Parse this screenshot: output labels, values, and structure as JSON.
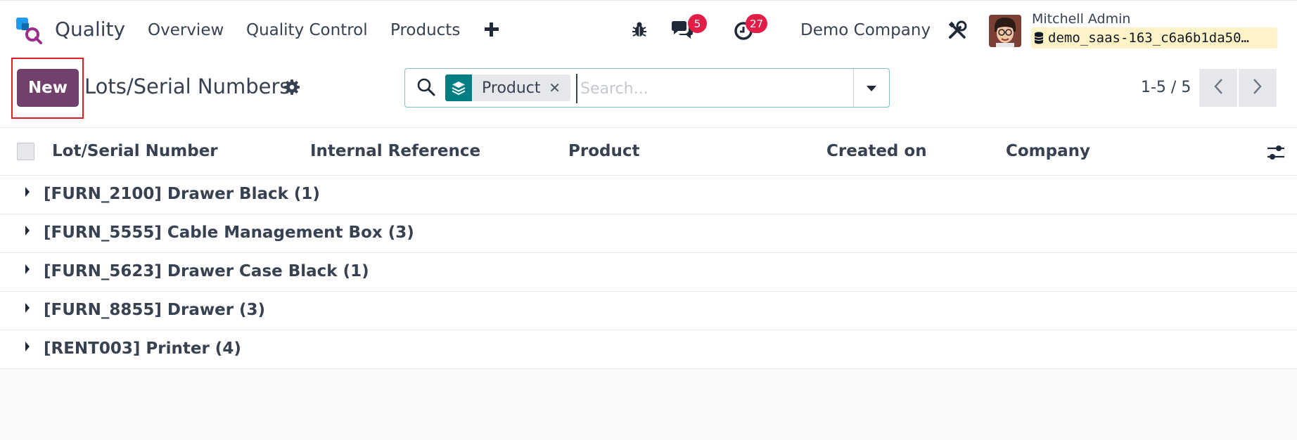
{
  "app": {
    "name": "Quality",
    "menu": [
      "Overview",
      "Quality Control",
      "Products"
    ]
  },
  "systray": {
    "messages_count": "5",
    "activities_count": "27",
    "company": "Demo Company",
    "user_name": "Mitchell Admin",
    "database": "demo_saas-163_c6a6b1da50…"
  },
  "control": {
    "new_label": "New",
    "title": "Lots/Serial Numbers",
    "search": {
      "facet": "Product",
      "placeholder": "Search..."
    },
    "pager": "1-5 / 5"
  },
  "list": {
    "columns": [
      "Lot/Serial Number",
      "Internal Reference",
      "Product",
      "Created on",
      "Company"
    ],
    "groups": [
      "[FURN_2100] Drawer Black (1)",
      "[FURN_5555] Cable Management Box (3)",
      "[FURN_5623] Drawer Case Black (1)",
      "[FURN_8855] Drawer (3)",
      "[RENT003] Printer (4)"
    ]
  },
  "colors": {
    "primary": "#71406b",
    "facet": "#017e84",
    "badge": "#e11d48",
    "highlight": "#e11d24"
  },
  "icons": [
    "quality-logo-icon",
    "plus-icon",
    "bug-icon",
    "chat-icon",
    "clock-icon",
    "settings-tools-icon",
    "database-icon",
    "gear-icon",
    "search-icon",
    "layers-icon",
    "close-icon",
    "caret-down-icon",
    "chevron-left-icon",
    "chevron-right-icon",
    "sliders-icon",
    "caret-right-icon"
  ]
}
